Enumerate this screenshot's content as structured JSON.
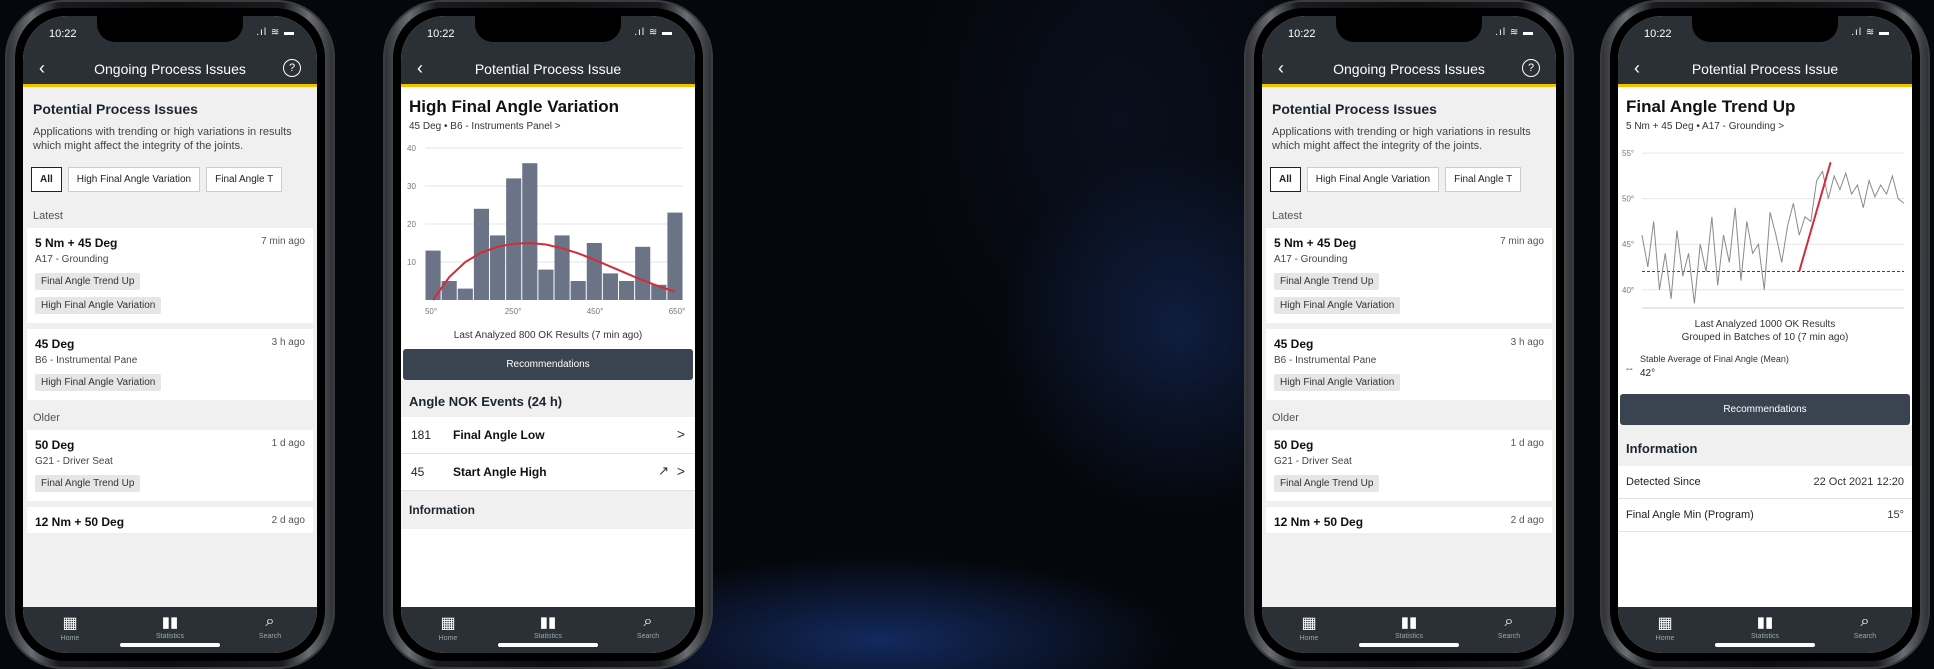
{
  "status": {
    "time": "10:22",
    "signal": ".ıl ≋ ▬"
  },
  "list_screen": {
    "nav_title": "Ongoing Process Issues",
    "help_label": "?",
    "heading": "Potential Process Issues",
    "description": "Applications with trending or high variations in results which might affect the integrity of the joints.",
    "filters": [
      "All",
      "High Final Angle Variation",
      "Final Angle T"
    ],
    "group_latest": "Latest",
    "group_older": "Older",
    "cards": [
      {
        "title": "5 Nm + 45 Deg",
        "ago": "7 min ago",
        "sub": "A17 - Grounding",
        "tags": [
          "Final Angle Trend Up",
          "High Final Angle Variation"
        ]
      },
      {
        "title": "45 Deg",
        "ago": "3 h ago",
        "sub": "B6 - Instrumental Pane",
        "tags": [
          "High Final Angle Variation"
        ]
      },
      {
        "title": "50 Deg",
        "ago": "1 d ago",
        "sub": "G21 - Driver Seat",
        "tags": [
          "Final Angle Trend Up"
        ]
      },
      {
        "title": "12 Nm + 50 Deg",
        "ago": "2 d ago",
        "sub": "",
        "tags": []
      }
    ]
  },
  "tabs": [
    {
      "label": "Home",
      "icon": "grid-icon"
    },
    {
      "label": "Statistics",
      "icon": "bar-chart-icon"
    },
    {
      "label": "Search",
      "icon": "search-icon"
    }
  ],
  "variation_screen": {
    "nav_title": "Potential Process Issue",
    "heading": "High Final Angle Variation",
    "breadcrumb": "45 Deg  •  B6 - Instruments Panel  >",
    "caption": "Last Analyzed 800 OK Results (7 min ago)",
    "recommendations": "Recommendations",
    "nok_heading": "Angle NOK Events (24 h)",
    "nok_rows": [
      {
        "count": "181",
        "label": "Final Angle Low",
        "chev": ">",
        "trend": ""
      },
      {
        "count": "45",
        "label": "Start Angle High",
        "chev": ">",
        "trend": "↗"
      }
    ],
    "info_heading": "Information"
  },
  "trend_screen": {
    "nav_title": "Potential Process Issue",
    "heading": "Final Angle Trend Up",
    "breadcrumb": "5 Nm + 45 Deg  •  A17 - Grounding  >",
    "caption_line1": "Last Analyzed 1000 OK Results",
    "caption_line2": "Grouped in Batches of 10 (7 min ago)",
    "legend_label": "Stable Average of Final Angle (Mean)",
    "legend_value": "42°",
    "recommendations": "Recommendations",
    "info_heading": "Information",
    "info_rows": [
      {
        "key": "Detected Since",
        "value": "22 Oct 2021 12:20"
      },
      {
        "key": "Final Angle Min (Program)",
        "value": "15°"
      }
    ]
  },
  "chart_data": [
    {
      "type": "bar",
      "title": "",
      "xlabel": "",
      "ylabel": "",
      "x_tick_labels": [
        "50°",
        "250°",
        "450°",
        "650°"
      ],
      "y_tick_labels": [
        "10",
        "20",
        "30",
        "40"
      ],
      "ylim": [
        0,
        40
      ],
      "values": [
        13,
        5,
        3,
        24,
        17,
        32,
        36,
        8,
        17,
        5,
        15,
        7,
        5,
        14,
        4,
        23
      ],
      "overlay": {
        "type": "line",
        "name": "",
        "color": "#d42b3a",
        "values": [
          0,
          6,
          10,
          12.5,
          14,
          14.8,
          15,
          14.6,
          13.6,
          12.3,
          10.6,
          8.8,
          7,
          5.2,
          3.6,
          2.2
        ]
      },
      "grid": true
    },
    {
      "type": "line",
      "title": "",
      "xlabel": "",
      "ylabel": "",
      "y_tick_labels": [
        "40°",
        "45°",
        "50°",
        "55°"
      ],
      "ylim": [
        38,
        56
      ],
      "grid": true,
      "series": [
        {
          "name": "",
          "color": "#8a8a8a",
          "values": [
            46,
            42.5,
            47.5,
            40,
            44,
            39,
            46.5,
            41.5,
            44,
            38.5,
            45,
            42,
            48,
            40.5,
            46,
            43,
            49,
            41,
            47.5,
            44,
            45,
            40,
            48.5,
            46,
            43,
            47,
            49.5,
            46,
            48,
            47.5,
            52,
            53,
            50,
            52.5,
            51,
            52.8,
            50.5,
            51.5,
            49,
            52,
            50.2,
            51.5,
            50.5,
            52.5,
            50,
            49.5
          ]
        },
        {
          "name": "",
          "color": "#d42b3a",
          "type": "trend",
          "values": [
            42,
            54
          ]
        }
      ],
      "reference": {
        "name": "Stable Average of Final Angle (Mean)",
        "value": 42
      }
    }
  ],
  "colors": {
    "accent": "#f2c200",
    "navbar": "#2b2f36",
    "button": "#3a4350",
    "bars": "#6b7487",
    "trend": "#d42b3a"
  }
}
